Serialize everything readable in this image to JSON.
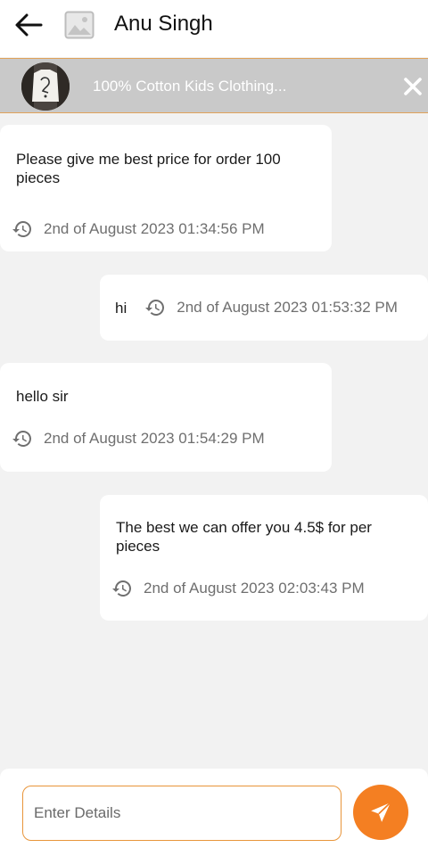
{
  "header": {
    "contact_name": "Anu Singh",
    "back_icon": "arrow-left-icon",
    "avatar_icon": "image-placeholder-icon"
  },
  "product": {
    "title": "100% Cotton Kids Clothing...",
    "close_icon": "close-icon",
    "banner_color": "#c9c9c9",
    "border_color": "#e0a25a"
  },
  "messages": [
    {
      "side": "incoming",
      "text": "Please give me best price for order 100 pieces",
      "timestamp": "2nd of August 2023 01:34:56 PM"
    },
    {
      "side": "outgoing",
      "text": "hi",
      "timestamp": "2nd of August 2023 01:53:32 PM"
    },
    {
      "side": "incoming",
      "text": "hello sir",
      "timestamp": "2nd of August 2023 01:54:29 PM"
    },
    {
      "side": "outgoing",
      "text": "The best we can offer you 4.5$ for per pieces",
      "timestamp": "2nd of August 2023 02:03:43 PM"
    }
  ],
  "composer": {
    "placeholder": "Enter Details",
    "value": "",
    "send_icon": "send-icon",
    "accent_color": "#f47f22"
  }
}
